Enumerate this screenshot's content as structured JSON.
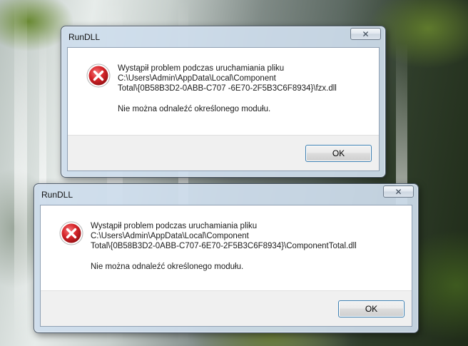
{
  "colors": {
    "error_red": "#d8262b",
    "ok_border": "#3c7fb1"
  },
  "dialogs": [
    {
      "title": "RunDLL",
      "close_label": "✕",
      "icon": "error-icon",
      "line1": "Wystąpił problem podczas uruchamiania pliku",
      "line2": "C:\\Users\\Admin\\AppData\\Local\\Component",
      "line3": "Total\\{0B58B3D2-0ABB-C707 -6E70-2F5B3C6F8934}\\fzx.dll",
      "line4": "Nie można odnaleźć określonego modułu.",
      "ok_label": "OK"
    },
    {
      "title": "RunDLL",
      "close_label": "✕",
      "icon": "error-icon",
      "line1": "Wystąpił problem podczas uruchamiania pliku",
      "line2": "C:\\Users\\Admin\\AppData\\Local\\Component",
      "line3": "Total\\{0B58B3D2-0ABB-C707-6E70-2F5B3C6F8934}\\ComponentTotal.dll",
      "line4": "Nie można odnaleźć określonego modułu.",
      "ok_label": "OK"
    }
  ]
}
